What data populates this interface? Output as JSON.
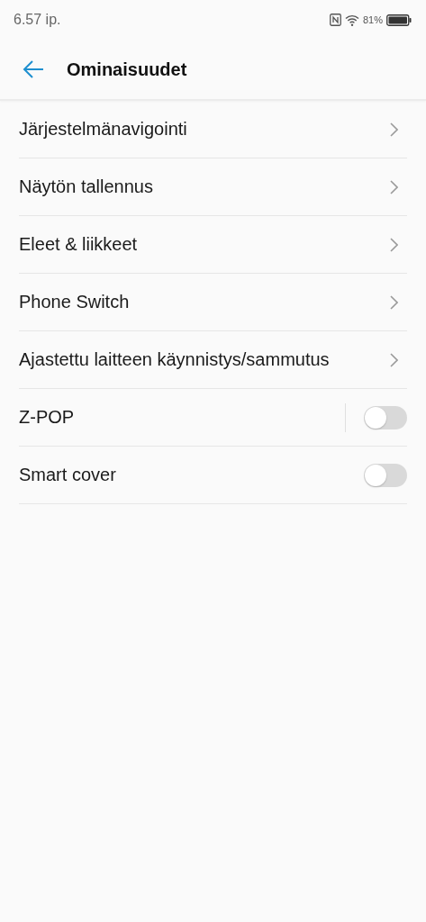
{
  "status_bar": {
    "time": "6.57 ip.",
    "battery": "81%"
  },
  "header": {
    "title": "Ominaisuudet"
  },
  "items": [
    {
      "kind": "link",
      "label": "Järjestelmänavigointi"
    },
    {
      "kind": "link",
      "label": "Näytön tallennus"
    },
    {
      "kind": "link",
      "label": "Eleet & liikkeet"
    },
    {
      "kind": "link",
      "label": "Phone Switch"
    },
    {
      "kind": "link",
      "label": "Ajastettu laitteen käynnistys/sammutus"
    },
    {
      "kind": "split_toggle",
      "label": "Z-POP",
      "on": false
    },
    {
      "kind": "toggle",
      "label": "Smart cover",
      "on": false
    }
  ]
}
